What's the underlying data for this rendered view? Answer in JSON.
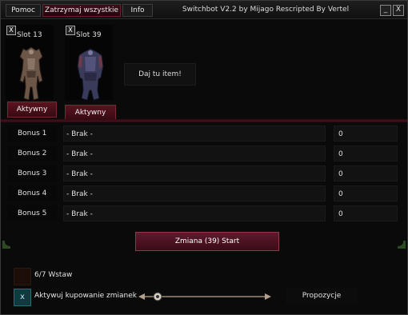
{
  "menu": {
    "help_label": "Pomoc",
    "stop_all_label": "Zatrzymaj wszystkie",
    "info_label": "Info"
  },
  "window": {
    "title": "Switchbot V2.2 by Mijago Rescripted By Vertel",
    "minimize_glyph": "_",
    "close_glyph": "X"
  },
  "slots": [
    {
      "close_glyph": "X",
      "label": "Slot 13",
      "status": "Aktywny",
      "icon": "armor-icon"
    },
    {
      "close_glyph": "X",
      "label": "Slot 39",
      "status": "Aktywny",
      "icon": "armor-icon"
    }
  ],
  "drop_zone": {
    "label": "Daj tu item!"
  },
  "bonuses": [
    {
      "label": "Bonus 1",
      "value": "- Brak -",
      "amount": "0"
    },
    {
      "label": "Bonus 2",
      "value": "- Brak -",
      "amount": "0"
    },
    {
      "label": "Bonus 3",
      "value": "- Brak -",
      "amount": "0"
    },
    {
      "label": "Bonus 4",
      "value": "- Brak -",
      "amount": "0"
    },
    {
      "label": "Bonus 5",
      "value": "- Brak -",
      "amount": "0"
    }
  ],
  "start_button": {
    "label": "Zmiana (39) Start"
  },
  "footer": {
    "insert_label": "6/7 Wstaw",
    "buy_check_glyph": "x",
    "buy_label": "Aktywuj kupowanie zmianek",
    "slider_level": 0.1,
    "proposals_label": "Propozycje"
  },
  "colors": {
    "accent": "#5a1420",
    "background": "#0a0a0a",
    "text": "#e0e0e0"
  }
}
